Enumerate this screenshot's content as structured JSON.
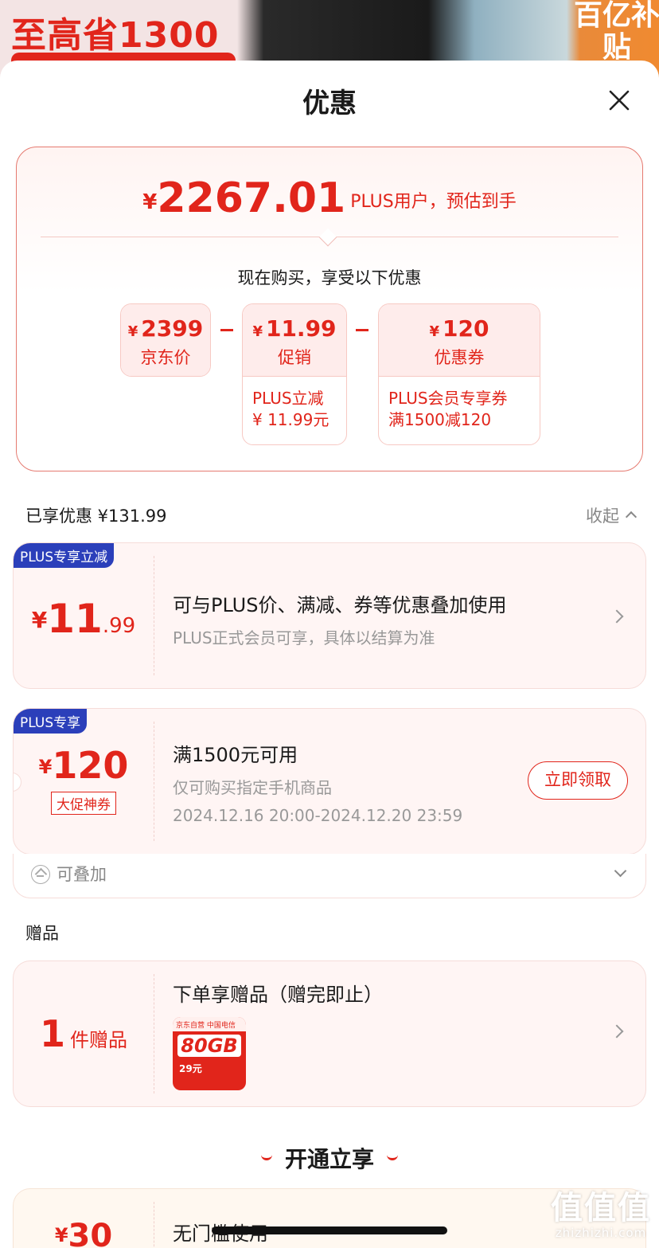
{
  "background": {
    "banner_text": "至高省1300",
    "badge_text": "百亿补贴"
  },
  "sheet": {
    "title": "优惠"
  },
  "summary": {
    "currency": "¥",
    "final_price": "2267.01",
    "final_suffix": "PLUS用户，预估到手",
    "subtitle": "现在购买，享受以下优惠",
    "boxes": [
      {
        "amount": "2399",
        "label": "京东价"
      },
      {
        "amount": "11.99",
        "label": "促销",
        "note_line1": "PLUS立减",
        "note_line2": "¥ 11.99元"
      },
      {
        "amount": "120",
        "label": "优惠券",
        "note_line1": "PLUS会员专享券",
        "note_line2": "满1500减120"
      }
    ]
  },
  "enjoyed": {
    "label": "已享优惠 ¥131.99",
    "collapse_label": "收起"
  },
  "promo_card": {
    "tag": "PLUS专享立减",
    "amount_int": "11",
    "amount_dec": ".99",
    "title": "可与PLUS价、满减、券等优惠叠加使用",
    "subtitle": "PLUS正式会员可享，具体以结算为准"
  },
  "coupon_card": {
    "tag": "PLUS专享",
    "amount": "120",
    "badge": "大促神券",
    "title": "满1500元可用",
    "subtitle": "仅可购买指定手机商品",
    "validity": "2024.12.16 20:00-2024.12.20 23:59",
    "button": "立即领取",
    "stackable": "可叠加"
  },
  "gift": {
    "section_title": "赠品",
    "count": "1",
    "count_unit": "件赠品",
    "title": "下单享赠品（赠完即止）",
    "card_brand": "京东自营  中国电信",
    "card_capacity": "80GB",
    "card_price": "29元"
  },
  "open": {
    "title": "开通立享"
  },
  "last_card": {
    "amount": "30",
    "title": "无门槛使用"
  },
  "watermark": {
    "line1": "值值值",
    "line2": "zhizhizhi.com"
  },
  "colors": {
    "accent_red": "#e1251b",
    "plus_blue": "#2b3fba"
  }
}
